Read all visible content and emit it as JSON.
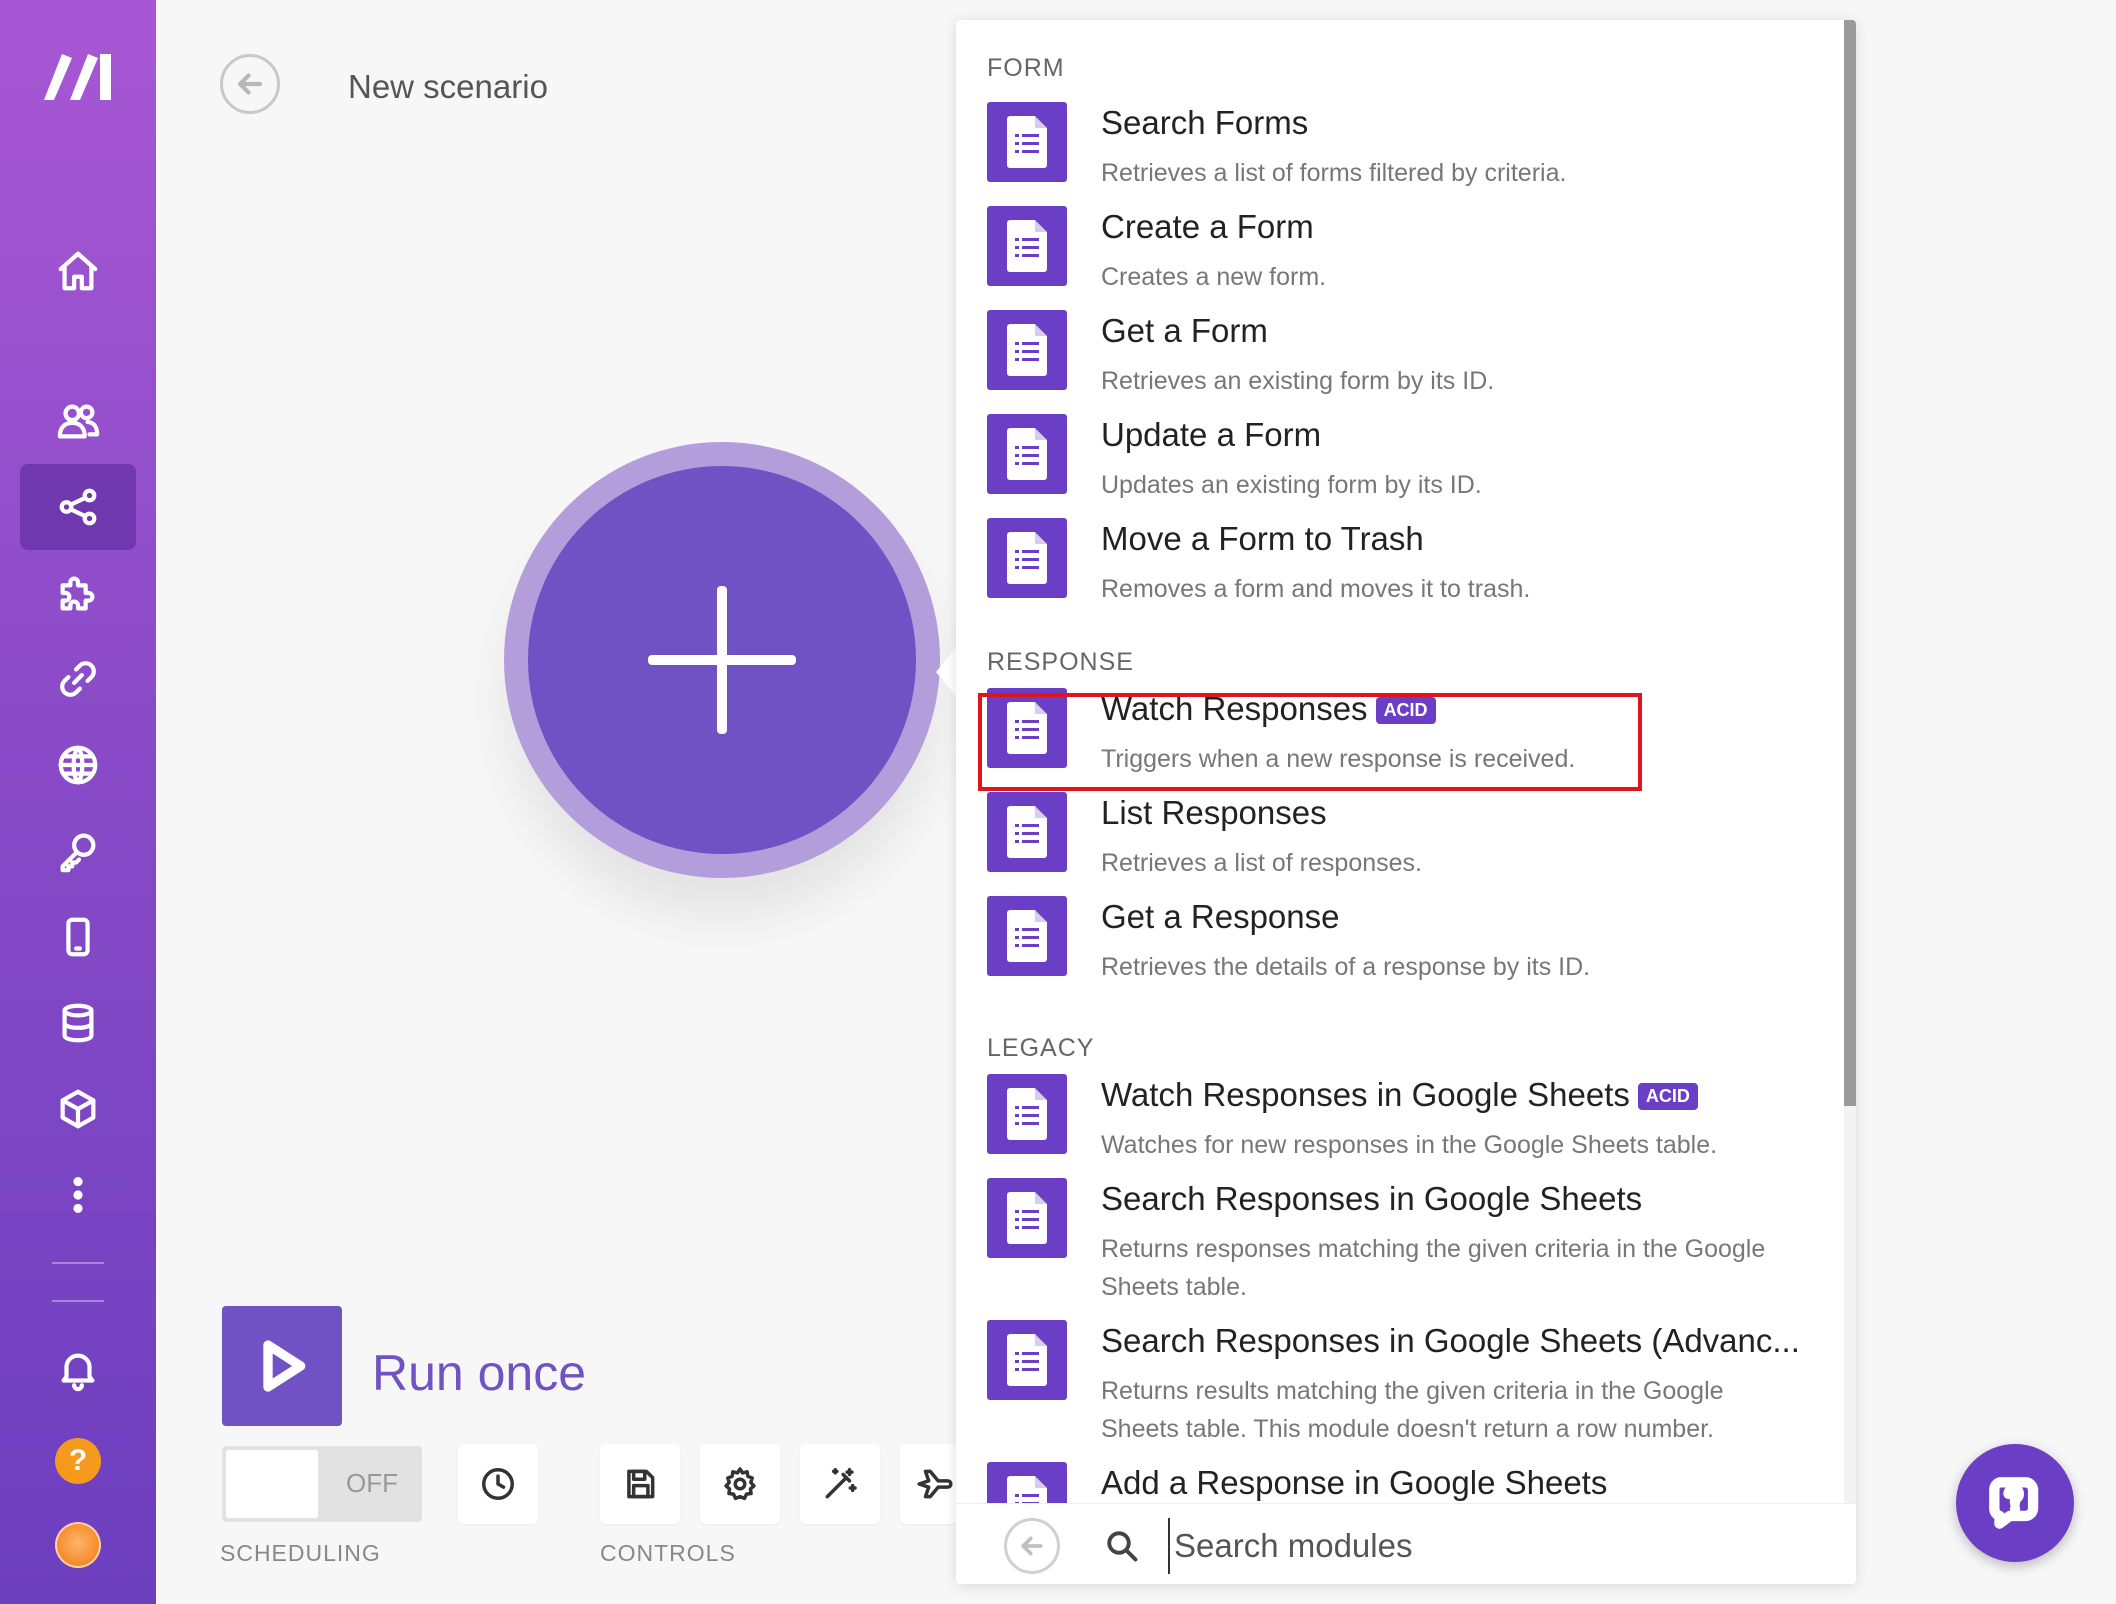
{
  "header": {
    "title": "New scenario"
  },
  "sidebar": {
    "items": [
      {
        "name": "home-icon"
      },
      {
        "name": "team-icon"
      },
      {
        "name": "scenarios-icon",
        "active": true
      },
      {
        "name": "templates-puzzle-icon"
      },
      {
        "name": "connections-link-icon"
      },
      {
        "name": "webhooks-globe-icon"
      },
      {
        "name": "keys-icon"
      },
      {
        "name": "devices-icon"
      },
      {
        "name": "data-stores-icon"
      },
      {
        "name": "data-structures-icon"
      },
      {
        "name": "more-icon"
      }
    ],
    "help_badge": "?"
  },
  "controls": {
    "run_label": "Run once",
    "toggle_state": "OFF",
    "scheduling_caption": "SCHEDULING",
    "controls_caption": "CONTROLS"
  },
  "picker": {
    "groups": [
      {
        "label": "FORM",
        "items": [
          {
            "title": "Search Forms",
            "desc": "Retrieves a list of forms filtered by criteria."
          },
          {
            "title": "Create a Form",
            "desc": "Creates a new form."
          },
          {
            "title": "Get a Form",
            "desc": "Retrieves an existing form by its ID."
          },
          {
            "title": "Update a Form",
            "desc": "Updates an existing form by its ID."
          },
          {
            "title": "Move a Form to Trash",
            "desc": "Removes a form and moves it to trash."
          }
        ]
      },
      {
        "label": "RESPONSE",
        "items": [
          {
            "title": "Watch Responses",
            "badge": "ACID",
            "desc": "Triggers when a new response is received.",
            "highlighted": true
          },
          {
            "title": "List Responses",
            "desc": "Retrieves a list of responses."
          },
          {
            "title": "Get a Response",
            "desc": "Retrieves the details of a response by its ID."
          }
        ]
      },
      {
        "label": "LEGACY",
        "items": [
          {
            "title": "Watch Responses in Google Sheets",
            "badge": "ACID",
            "desc": "Watches for new responses in the Google Sheets table."
          },
          {
            "title": "Search Responses in Google Sheets",
            "desc": "Returns responses matching the given criteria in the Google Sheets table."
          },
          {
            "title": "Search Responses in Google Sheets (Advanc...",
            "desc": "Returns results matching the given criteria in the Google Sheets table. This module doesn't return a row number."
          },
          {
            "title": "Add a Response in Google Sheets",
            "desc": ""
          }
        ]
      }
    ],
    "search_placeholder": "Search modules"
  },
  "colors": {
    "brand": "#6b3ec6",
    "highlight": "#e0141c"
  }
}
